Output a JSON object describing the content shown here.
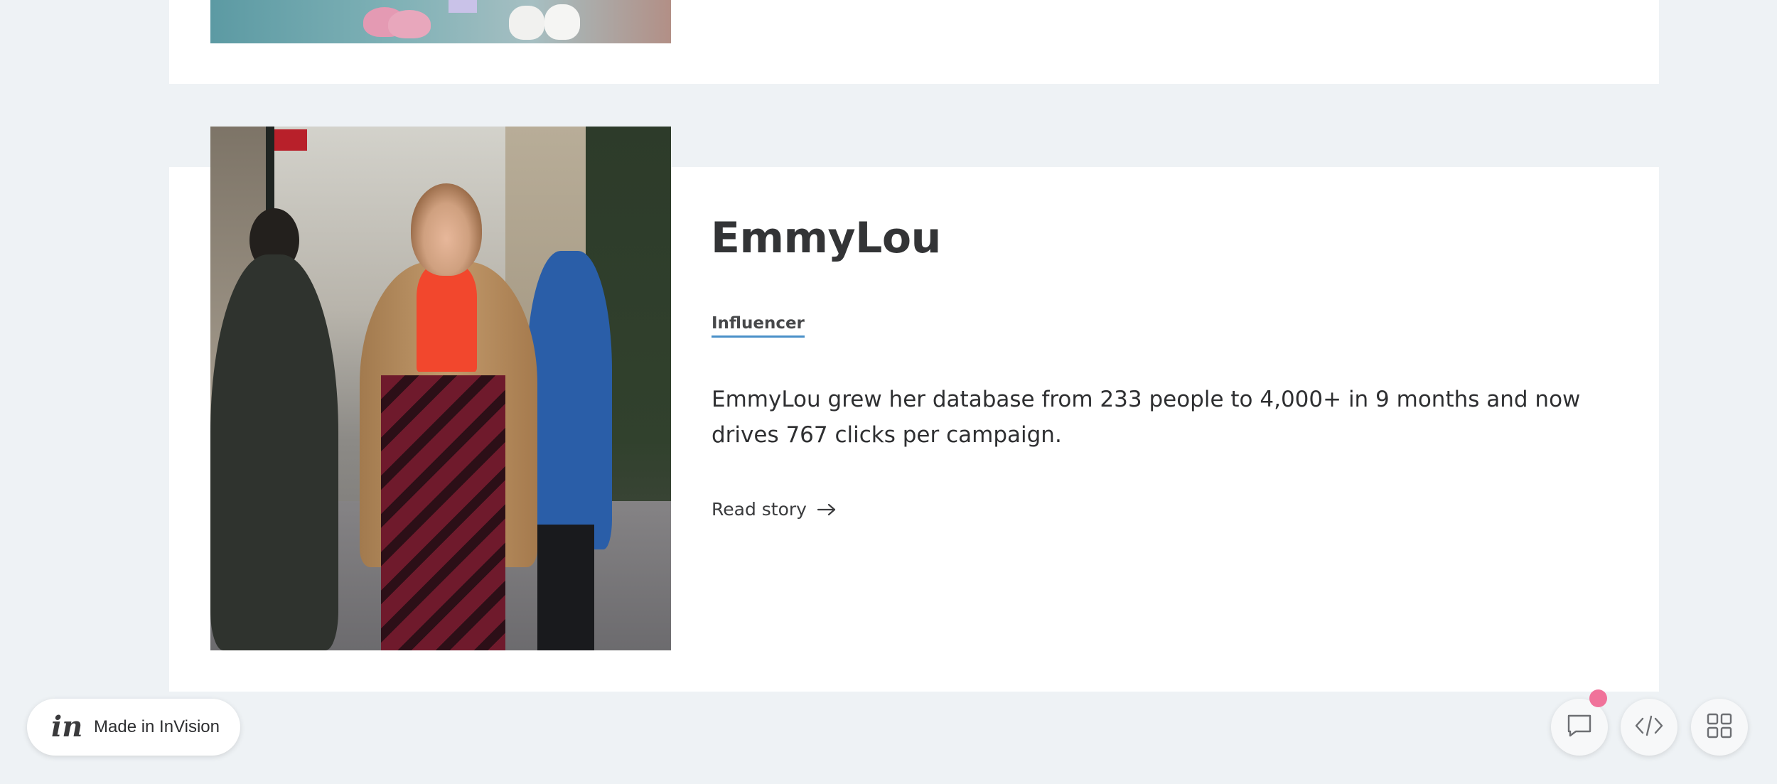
{
  "previous_card": {
    "image_alt": "shoes-photo"
  },
  "story": {
    "title": "EmmyLou",
    "tag": "Influencer",
    "description": "EmmyLou grew her database from 233 people to 4,000+ in 9 months and now drives 767 clicks per campaign.",
    "read_more_label": "Read story",
    "image_alt": "EmmyLou walking on city street"
  },
  "footer": {
    "badge_label": "Made in InVision",
    "badge_logo": "in"
  },
  "toolbar": {
    "buttons": [
      {
        "icon": "comment-icon"
      },
      {
        "icon": "code-icon"
      },
      {
        "icon": "grid-icon"
      }
    ],
    "notification_color": "#f0729a"
  },
  "colors": {
    "background": "#eef2f5",
    "card": "#ffffff",
    "tag_underline": "#4a90c8",
    "title": "#333436"
  }
}
